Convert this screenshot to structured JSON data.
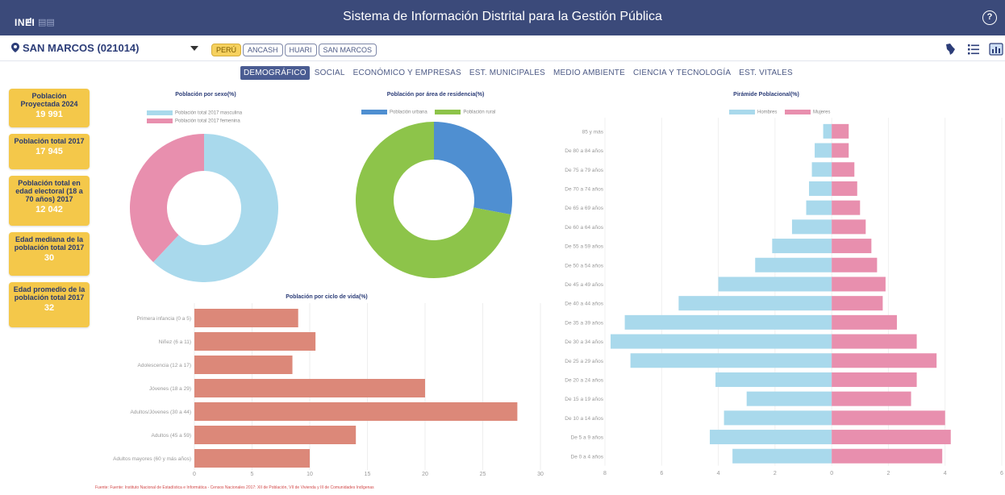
{
  "header": {
    "logo_text": "INEI",
    "title": "Sistema de Información Distrital para la Gestión Pública",
    "help_icon": "question-circle-icon"
  },
  "location": {
    "selected": "SAN MARCOS (021014)",
    "breadcrumbs": [
      "PERÚ",
      "ANCASH",
      "HUARI",
      "SAN MARCOS"
    ]
  },
  "tabs": [
    "DEMOGRÁFICO",
    "SOCIAL",
    "ECONÓMICO Y EMPRESAS",
    "EST. MUNICIPALES",
    "MEDIO AMBIENTE",
    "CIENCIA Y TECNOLOGÍA",
    "EST. VITALES"
  ],
  "kpis": [
    {
      "label": "Población Proyectada 2024",
      "value": "19 991"
    },
    {
      "label": "Población total 2017",
      "value": "17 945"
    },
    {
      "label": "Población total en edad electoral (18 a 70 años) 2017",
      "value": "12 042"
    },
    {
      "label": "Edad mediana de la población total 2017",
      "value": "30"
    },
    {
      "label": "Edad promedio de la población total 2017",
      "value": "32"
    }
  ],
  "colors": {
    "header": "#3b4a7a",
    "kpi": "#f4c84a",
    "male": "#a9d9ec",
    "female": "#e88fae",
    "urban": "#4f8fd1",
    "rural": "#8dc44a",
    "life_bar": "#dc8879"
  },
  "charts": {
    "sex": {
      "title": "Población por sexo(%)",
      "legend": [
        "Población total 2017 masculina",
        "Población total 2017 femenina"
      ]
    },
    "area": {
      "title": "Población por área de residencia(%)",
      "legend": [
        "Población urbana",
        "Población rural"
      ]
    },
    "pyramid": {
      "title": "Pirámide Poblacional(%)",
      "legend": [
        "Hombres",
        "Mujeres"
      ]
    },
    "life": {
      "title": "Población por ciclo de vida(%)"
    }
  },
  "chart_data": [
    {
      "type": "pie",
      "title": "Población por sexo(%)",
      "labels": [
        "Población total 2017 masculina",
        "Población total 2017 femenina"
      ],
      "values": [
        62,
        38
      ],
      "colors": [
        "#a9d9ec",
        "#e88fae"
      ]
    },
    {
      "type": "pie",
      "title": "Población por área de residencia(%)",
      "labels": [
        "Población urbana",
        "Población rural"
      ],
      "values": [
        28,
        72
      ],
      "colors": [
        "#4f8fd1",
        "#8dc44a"
      ]
    },
    {
      "type": "bar",
      "title": "Población por ciclo de vida(%)",
      "categories": [
        "Primera infancia (0 a 5)",
        "Niñez (6 a 11)",
        "Adolescencia (12 a 17)",
        "Jóvenes (18 a 29)",
        "Adultos/Jóvenes (30 a 44)",
        "Adultos (45 a 59)",
        "Adultos mayores (60 y más años)"
      ],
      "values": [
        9,
        10.5,
        8.5,
        20,
        28,
        14,
        10
      ],
      "xlim": [
        0,
        30
      ],
      "xticks": [
        0,
        5,
        10,
        15,
        20,
        25,
        30
      ]
    },
    {
      "type": "bar",
      "title": "Pirámide Poblacional(%)",
      "categories": [
        "85 y más",
        "De 80 a 84 años",
        "De 75 a 79 años",
        "De 70 a 74 años",
        "De 65 a 69 años",
        "De 60 a 64 años",
        "De 55 a 59 años",
        "De 50 a 54 años",
        "De 45 a 49 años",
        "De 40 a 44 años",
        "De 35 a 39 años",
        "De 30 a 34 años",
        "De 25 a 29 años",
        "De 20 a 24 años",
        "De 15 a 19 años",
        "De 10 a 14 años",
        "De 5 a 9 años",
        "De 0 a 4 años"
      ],
      "series": [
        {
          "name": "Hombres",
          "values": [
            0.3,
            0.6,
            0.7,
            0.8,
            0.9,
            1.4,
            2.1,
            2.7,
            4.0,
            5.4,
            7.3,
            7.8,
            7.1,
            4.1,
            3.0,
            3.8,
            4.3,
            3.5
          ]
        },
        {
          "name": "Mujeres",
          "values": [
            0.6,
            0.6,
            0.8,
            0.9,
            1.0,
            1.2,
            1.4,
            1.6,
            1.9,
            1.8,
            2.3,
            3.0,
            3.7,
            3.0,
            2.8,
            4.0,
            4.2,
            3.9
          ]
        }
      ],
      "xlim": [
        -8,
        6
      ],
      "xticks": [
        8,
        6,
        4,
        2,
        0,
        2,
        4,
        6
      ]
    }
  ],
  "footer": "Fuente: Fuente: Instituto Nacional de Estadística e Informática - Censos Nacionales 2017: XII de Población, VII de Vivienda y III de Comunidades Indígenas"
}
